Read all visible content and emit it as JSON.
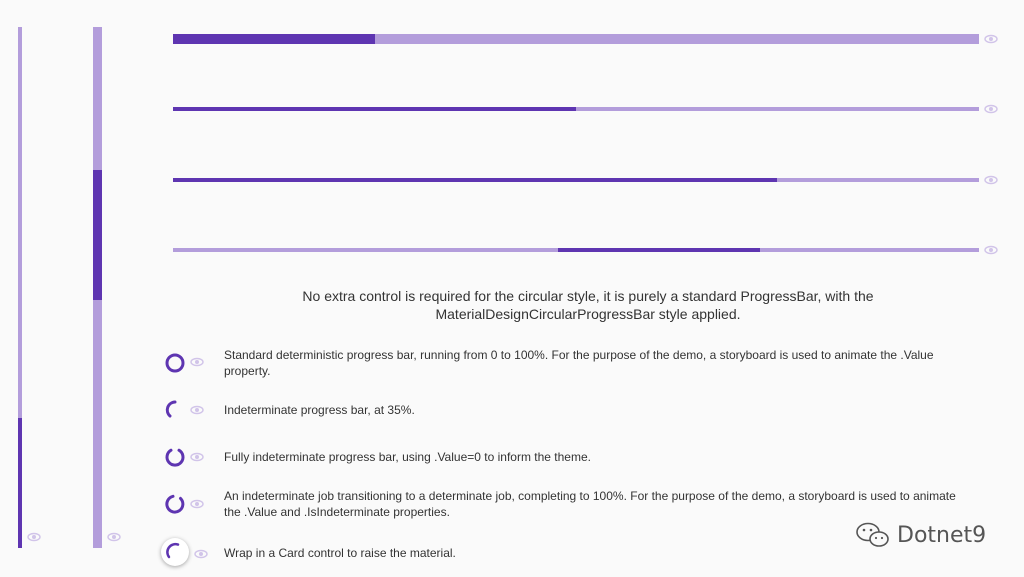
{
  "colors": {
    "primary": "#5e35b1",
    "primary_light": "#b39ddb",
    "background": "#fafafa"
  },
  "vertical_bars": [
    {
      "name": "vertical-progress-1",
      "value_percent": 25,
      "style": "bottom-fill"
    },
    {
      "name": "vertical-progress-2",
      "indeterminate": true
    }
  ],
  "horizontal_bars": [
    {
      "name": "thick-progress-bar",
      "value_percent": 25
    },
    {
      "name": "progress-bar-50",
      "value_percent": 50
    },
    {
      "name": "progress-bar-75",
      "value_percent": 75
    },
    {
      "name": "indeterminate-progress-bar",
      "indeterminate": true
    }
  ],
  "caption": {
    "line1": "No extra control is required for the circular style, it is purely a standard ProgressBar, with the",
    "line2": "MaterialDesignCircularProgressBar style applied."
  },
  "circular_rows": [
    {
      "icon": "circular-progress-full-icon",
      "text_line1": "Standard deterministic progress bar, running from 0 to 100%.  For the purpose of the demo, a storyboard is used to animate the .Value",
      "text_line2": "property."
    },
    {
      "icon": "circular-progress-35-icon",
      "text_line1": "Indeterminate progress bar, at 35%.",
      "text_line2": ""
    },
    {
      "icon": "circular-progress-indeterminate-icon",
      "text_line1": "Fully indeterminate progress bar, using .Value=0 to inform the theme.",
      "text_line2": ""
    },
    {
      "icon": "circular-progress-transition-icon",
      "text_line1": "An indeterminate job transitioning to a determinate job, completing to 100%.  For the purpose of the demo, a storyboard is used to animate",
      "text_line2": "the .Value and .IsIndeterminate properties."
    },
    {
      "icon": "card-circular-progress-icon",
      "text_line1": "Wrap in a Card control to raise the material.",
      "text_line2": ""
    }
  ],
  "watermark": {
    "text": "Dotnet9",
    "icon": "wechat-icon"
  }
}
